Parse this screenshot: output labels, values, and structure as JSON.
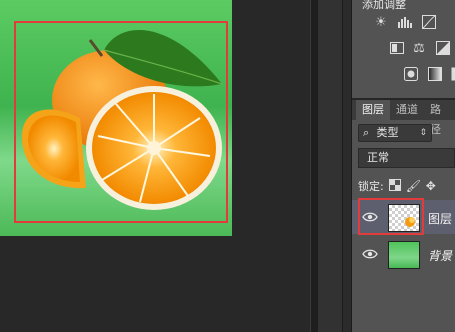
{
  "colors": {
    "highlight": "#e23b3b",
    "canvas_bg": "#282828",
    "panel_bg": "#535353",
    "selected_layer": "#5d5f6e"
  },
  "adjustments": {
    "title": "添加调整",
    "icons": [
      [
        "brightness-icon",
        "levels-icon",
        "curves-icon"
      ],
      [
        "vibrance-icon",
        "balance-icon",
        "bw-icon"
      ],
      [
        "photo-filter-icon",
        "gradient-map-icon",
        "selective-color-icon"
      ]
    ]
  },
  "layers_panel": {
    "tabs": [
      "图层",
      "通道",
      "路径"
    ],
    "filter_label": "类型",
    "blend_mode": "正常",
    "lock_label": "锁定:",
    "layers": [
      {
        "name": "图层",
        "thumbnail": "orange-transparent",
        "selected": true
      },
      {
        "name": "背景",
        "thumbnail": "green-background",
        "selected": false
      }
    ]
  }
}
